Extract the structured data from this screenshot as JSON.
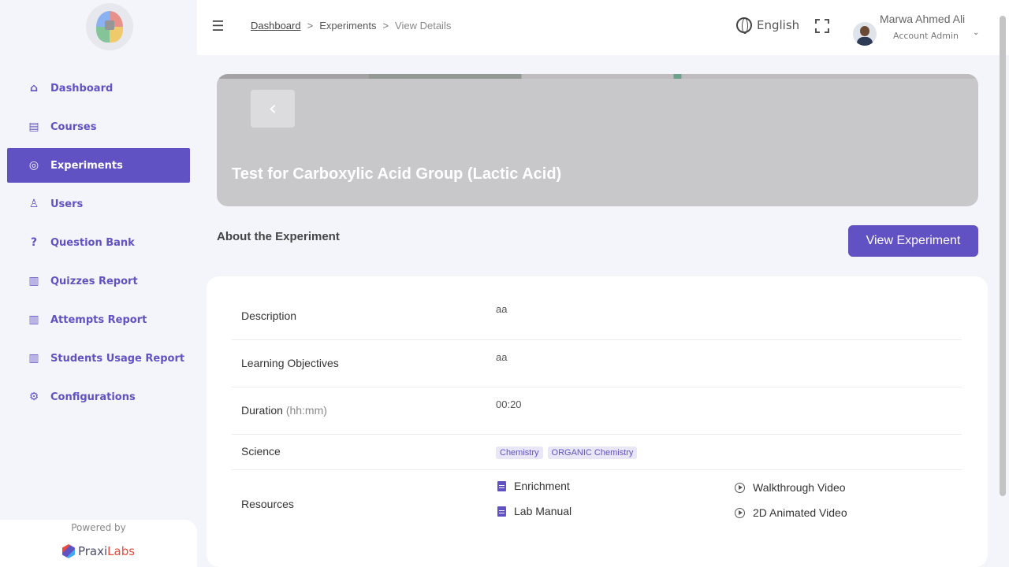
{
  "sidebar": {
    "items": [
      {
        "label": "Dashboard",
        "icon": "home-icon"
      },
      {
        "label": "Courses",
        "icon": "book-icon"
      },
      {
        "label": "Experiments",
        "icon": "aperture-icon",
        "active": true
      },
      {
        "label": "Users",
        "icon": "user-icon"
      },
      {
        "label": "Question Bank",
        "icon": "question-icon"
      },
      {
        "label": "Quizzes Report",
        "icon": "report-icon"
      },
      {
        "label": "Attempts Report",
        "icon": "report-icon"
      },
      {
        "label": "Students Usage Report",
        "icon": "report-icon"
      },
      {
        "label": "Configurations",
        "icon": "gear-icon"
      }
    ],
    "powered_by": "Powered by",
    "brand_a": "Praxi",
    "brand_b": "Labs"
  },
  "header": {
    "breadcrumb": [
      "Dashboard",
      "Experiments",
      "View Details"
    ],
    "separator": ">",
    "language": "English",
    "user_name": "Marwa Ahmed Ali",
    "user_role": "Account Admin"
  },
  "hero": {
    "back_icon": "‹",
    "title": "Test for Carboxylic Acid Group (Lactic Acid)"
  },
  "about": {
    "heading": "About the Experiment",
    "view_button": "View Experiment"
  },
  "details": {
    "description_label": "Description",
    "description_value": "aa",
    "objectives_label": "Learning Objectives",
    "objectives_value": "aa",
    "duration_label": "Duration",
    "duration_hint": "(hh:mm)",
    "duration_value": "00:20",
    "science_label": "Science",
    "science_tags": [
      "Chemistry",
      "ORGANIC Chemistry"
    ],
    "resources_label": "Resources",
    "resources": [
      {
        "label": "Enrichment",
        "icon": "document-icon"
      },
      {
        "label": "Walkthrough Video",
        "icon": "play-icon"
      },
      {
        "label": "Lab Manual",
        "icon": "document-icon"
      },
      {
        "label": "2D Animated Video",
        "icon": "play-icon"
      }
    ]
  },
  "colors": {
    "primary": "#6152c4",
    "background": "#f4f5fa",
    "card": "#ffffff"
  }
}
